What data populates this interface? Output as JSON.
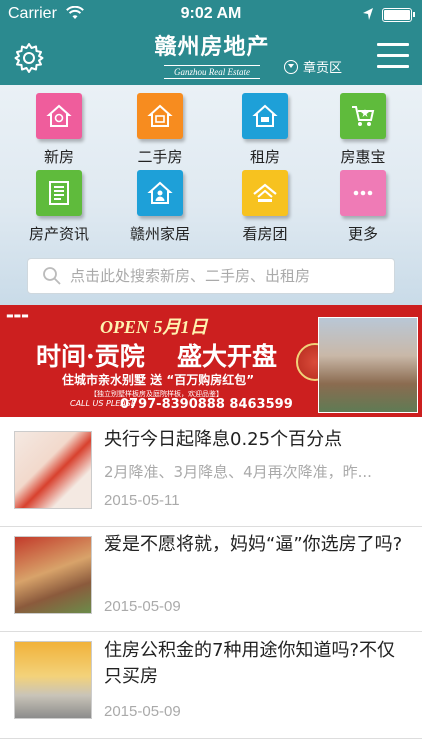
{
  "status_bar": {
    "carrier": "Carrier",
    "time": "9:02 AM"
  },
  "header": {
    "logo_cn": "赣州房地产",
    "logo_en": "Ganzhou Real Estate",
    "region": "章贡区"
  },
  "categories": [
    {
      "label": "新房",
      "color": "#ef5d9c",
      "icon": "house-icon"
    },
    {
      "label": "二手房",
      "color": "#f78c1f",
      "icon": "house-icon"
    },
    {
      "label": "租房",
      "color": "#1ea0d8",
      "icon": "house-icon"
    },
    {
      "label": "房惠宝",
      "color": "#5fbb3c",
      "icon": "cart-icon"
    },
    {
      "label": "房产资讯",
      "color": "#5fbb3c",
      "icon": "news-icon"
    },
    {
      "label": "赣州家居",
      "color": "#1ea0d8",
      "icon": "person-icon"
    },
    {
      "label": "看房团",
      "color": "#f7c21f",
      "icon": "roof-icon"
    },
    {
      "label": "更多",
      "color": "#ef5d9c",
      "icon": "more-icon"
    }
  ],
  "search": {
    "placeholder": "点击此处搜索新房、二手房、出租房"
  },
  "banner": {
    "open_text": "OPEN 5月1日",
    "title_left": "时间·贡院",
    "title_right": "盛大开盘",
    "subtitle": "住城市亲水别墅 送 “百万购房红包”",
    "small_text": "【独立别墅样板房及庭院样板，欢迎品鉴】",
    "call_us": "CALL US PLEASE",
    "phones": "0797-8390888 8463599"
  },
  "news": [
    {
      "title": "央行今日起降息0.25个百分点",
      "summary": "2月降准、3月降息、4月再次降准，昨...",
      "date": "2015-05-11"
    },
    {
      "title": "爱是不愿将就，妈妈“逼”你选房了吗?",
      "summary": "",
      "date": "2015-05-09"
    },
    {
      "title": "住房公积金的7种用途你知道吗?不仅只买房",
      "summary": "",
      "date": "2015-05-09"
    }
  ]
}
